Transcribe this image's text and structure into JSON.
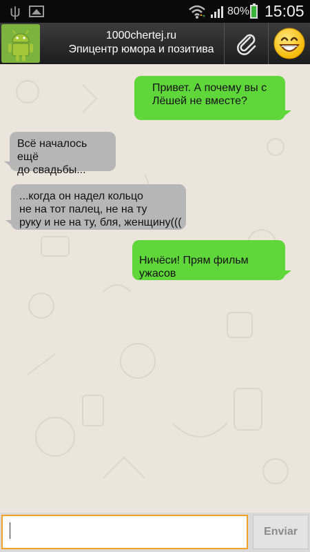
{
  "status_bar": {
    "icons": [
      "usb-icon",
      "image-icon",
      "wifi-icon",
      "signal-icon",
      "battery-icon"
    ],
    "battery_percent": "80%",
    "time": "15:05"
  },
  "header": {
    "contact_avatar": "android-robot-icon",
    "title": "1000chertej.ru",
    "subtitle": "Эпицентр юмора и позитива",
    "attach_icon": "paperclip-icon",
    "emoji_icon": "smiley-icon"
  },
  "messages": [
    {
      "direction": "outgoing",
      "text": "Привет. А почему вы с\nЛёшей не вместе?"
    },
    {
      "direction": "incoming",
      "text": "Всё началось ещё\nдо свадьбы..."
    },
    {
      "direction": "incoming",
      "text": "...когда он надел кольцо\nне на тот палец, не на ту\nруку и не на ту, бля, женщину((("
    },
    {
      "direction": "outgoing",
      "text": "Ничёси! Прям фильм ужасов"
    }
  ],
  "composer": {
    "value": "",
    "send_label": "Enviar"
  },
  "colors": {
    "outgoing_bubble": "#5fd63a",
    "incoming_bubble": "#b6b6b6",
    "input_border": "#f2a127"
  }
}
